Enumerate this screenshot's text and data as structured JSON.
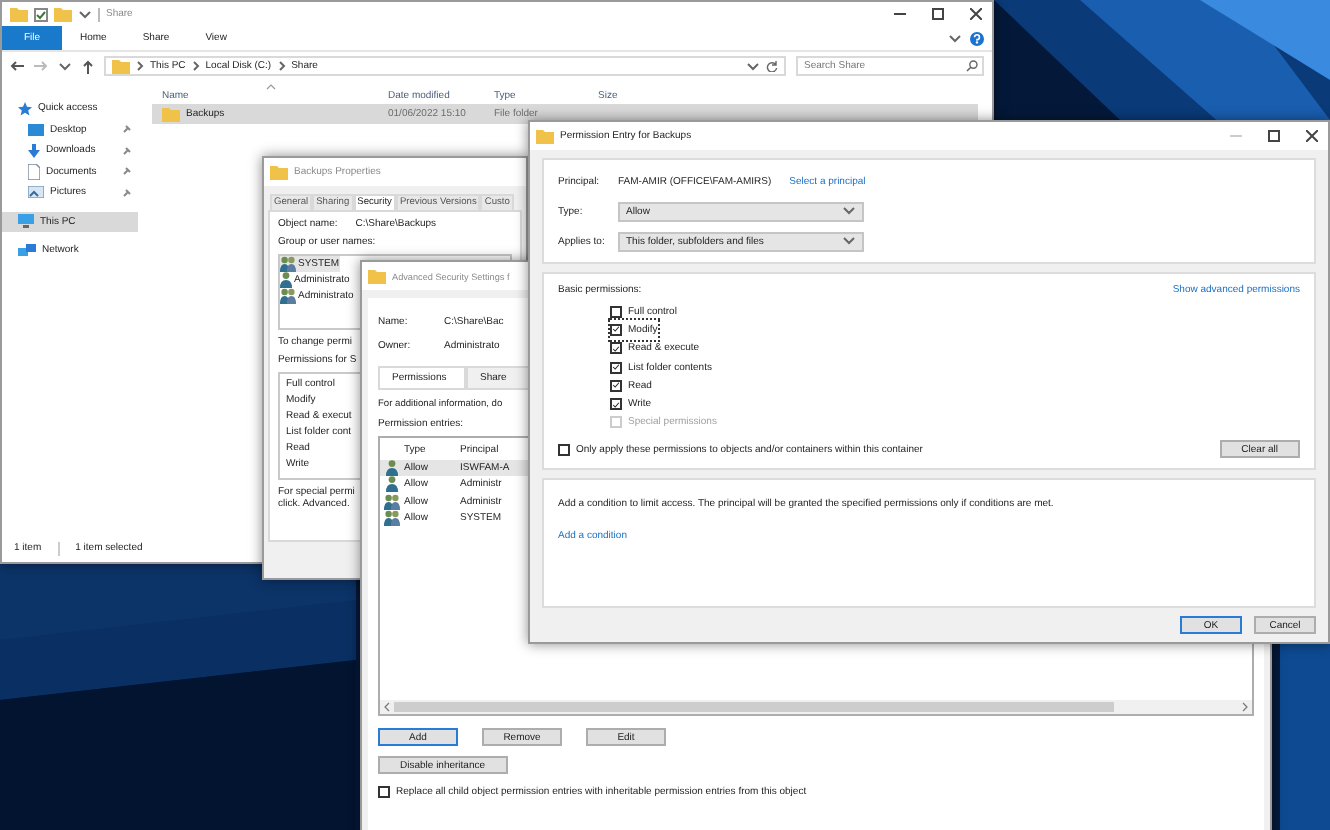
{
  "explorer": {
    "title": "Share",
    "file_menu": "File",
    "ribbon_tabs": [
      "Home",
      "Share",
      "View"
    ],
    "breadcrumb": [
      "This PC",
      "Local Disk (C:)",
      "Share"
    ],
    "search": {
      "placeholder": "Search Share"
    },
    "sidebar": [
      {
        "label": "Quick access",
        "kind": "star",
        "pinned": false,
        "selected": false,
        "children": [
          {
            "label": "Desktop",
            "kind": "desktop",
            "pinned": true,
            "selected": false
          },
          {
            "label": "Downloads",
            "kind": "download",
            "pinned": true,
            "selected": false
          },
          {
            "label": "Documents",
            "kind": "document",
            "pinned": true,
            "selected": false
          },
          {
            "label": "Pictures",
            "kind": "pictures",
            "pinned": true,
            "selected": false
          }
        ]
      },
      {
        "label": "This PC",
        "kind": "pc",
        "pinned": false,
        "selected": true
      },
      {
        "label": "Network",
        "kind": "network",
        "pinned": false,
        "selected": false
      }
    ],
    "columns": [
      "Name",
      "Date modified",
      "Type",
      "Size"
    ],
    "rows": [
      {
        "name": "Backups",
        "date": "01/06/2022 15:10",
        "type": "File folder",
        "selected": true
      }
    ],
    "status": [
      "1 item",
      "1 item selected"
    ]
  },
  "properties": {
    "title": "Backups Properties",
    "tabs": [
      {
        "label": "General",
        "selected": false
      },
      {
        "label": "Sharing",
        "selected": false
      },
      {
        "label": "Security",
        "selected": true
      },
      {
        "label": "Previous Versions",
        "selected": false
      },
      {
        "label": "Custo",
        "selected": false
      }
    ],
    "object_label": "Object name:",
    "object_value": "C:\\Share\\Backups",
    "group_label": "Group or user names:",
    "principals": [
      {
        "name": "SYSTEM",
        "kind": "group",
        "selected": true
      },
      {
        "name": "Administrato",
        "kind": "user",
        "selected": false
      },
      {
        "name": "Administrato",
        "kind": "group",
        "selected": false
      }
    ],
    "change_note": "To change permi",
    "permissions_label": "Permissions for S",
    "permissions": [
      "Full control",
      "Modify",
      "Read & execut",
      "List folder cont",
      "Read",
      "Write"
    ],
    "special_note": [
      "For special permi",
      "click. Advanced."
    ]
  },
  "advanced": {
    "title": "Advanced Security Settings f",
    "name_label": "Name:",
    "name_value": "C:\\Share\\Bac",
    "owner_label": "Owner:",
    "owner_value": "Administrato",
    "tabs": [
      {
        "label": "Permissions",
        "selected": true
      },
      {
        "label": "Share",
        "selected": false
      }
    ],
    "info": "For additional information, do",
    "entries_label": "Permission entries:",
    "columns": [
      "Type",
      "Principal"
    ],
    "entries": [
      {
        "type": "Allow",
        "principal": "ISWFAM-A",
        "kind": "user",
        "selected": true
      },
      {
        "type": "Allow",
        "principal": "Administr",
        "kind": "user",
        "selected": false
      },
      {
        "type": "Allow",
        "principal": "Administr",
        "kind": "group",
        "selected": false
      },
      {
        "type": "Allow",
        "principal": "SYSTEM",
        "kind": "group",
        "selected": false
      }
    ],
    "buttons": [
      {
        "label": "Add",
        "default": true
      },
      {
        "label": "Remove",
        "default": false
      },
      {
        "label": "Edit",
        "default": false
      }
    ],
    "disable_inheritance": "Disable inheritance",
    "replace": {
      "label": "Replace all child object permission entries with inheritable permission entries from this object",
      "checked": false
    }
  },
  "entry": {
    "title": "Permission Entry for Backups",
    "principal_label": "Principal:",
    "principal_value": "FAM-AMIR (OFFICE\\FAM-AMIRS)",
    "select_principal": "Select a principal",
    "type_label": "Type:",
    "type_value": "Allow",
    "applies_label": "Applies to:",
    "applies_value": "This folder, subfolders and files",
    "basic_label": "Basic permissions:",
    "advanced_link": "Show advanced permissions",
    "permissions": [
      {
        "label": "Full control",
        "checked": false,
        "disabled": false,
        "focused": false
      },
      {
        "label": "Modify",
        "checked": true,
        "disabled": false,
        "focused": true
      },
      {
        "label": "Read & execute",
        "checked": true,
        "disabled": false,
        "focused": false
      },
      {
        "label": "List folder contents",
        "checked": true,
        "disabled": false,
        "focused": false
      },
      {
        "label": "Read",
        "checked": true,
        "disabled": false,
        "focused": false
      },
      {
        "label": "Write",
        "checked": true,
        "disabled": false,
        "focused": false
      },
      {
        "label": "Special permissions",
        "checked": false,
        "disabled": true,
        "focused": false
      }
    ],
    "only_apply": {
      "label": "Only apply these permissions to objects and/or containers within this container",
      "checked": false
    },
    "clear_all": "Clear all",
    "condition_text": "Add a condition to limit access. The principal will be granted the specified permissions only if conditions are met.",
    "add_condition": "Add a condition",
    "buttons": [
      {
        "label": "OK",
        "default": true
      },
      {
        "label": "Cancel",
        "default": false
      }
    ]
  }
}
